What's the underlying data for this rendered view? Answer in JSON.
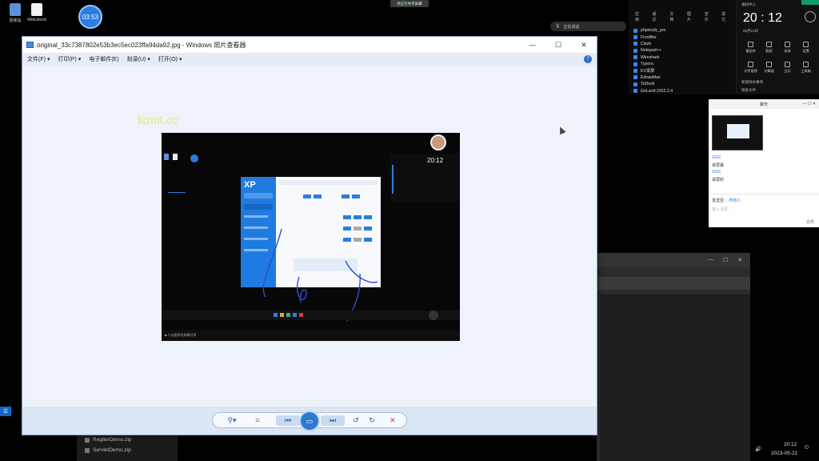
{
  "desktop": {
    "icons": [
      {
        "label": "回收站",
        "icon": "recycle-bin-icon"
      },
      {
        "label": "WebJsond",
        "icon": "document-icon"
      }
    ],
    "timer": "03:53",
    "top_banner": "你正在共享屏幕",
    "voice_chip": "正在讲话"
  },
  "launcher": {
    "tabs": [
      "应用",
      "最近",
      "文档",
      "图片",
      "音乐",
      "其它"
    ],
    "apps": [
      "phpstudy_pro",
      "FrostBer",
      "Clash",
      "Notepad++",
      "Wireshark",
      "Typora",
      "EV录屏",
      "EdrawMax",
      "ToDesk",
      "GoLand 2022.2.4"
    ]
  },
  "clock_panel": {
    "header": "通知中心",
    "time": "20 : 12",
    "date": "05月21日",
    "items": [
      "番茄钟",
      "截图",
      "录屏",
      "设置",
      "文件管理",
      "计算器",
      "日历",
      "工具箱"
    ],
    "footer1": "新建待办事项",
    "footer2": "搜索文件"
  },
  "chat": {
    "title": "聊天",
    "messages": [
      {
        "text": "GGC",
        "blue": true
      },
      {
        "text": "讲屏幕",
        "blue": false
      },
      {
        "text": "GGC",
        "blue": true
      },
      {
        "text": "讲屏的",
        "blue": false
      }
    ],
    "send_to_label": "发送至：",
    "send_to_value": "所有人",
    "input_placeholder": "输入消息...",
    "file_label": "文件"
  },
  "viewer": {
    "title": "original_33c7387802e53b3ec5ec023ffa94da92.jpg - Windows 照片查看器",
    "menu": [
      "文件(F)",
      "打印(P)",
      "电子邮件(E)",
      "刻录(U)",
      "打开(O)"
    ],
    "watermark": "fcmit.cc",
    "controls": {
      "minimize": "—",
      "maximize": "☐",
      "close": "✕",
      "help": "?"
    },
    "toolbar": {
      "zoom": "⚲▾",
      "fit": "⌗",
      "prev": "⏮",
      "slideshow": "▭",
      "next": "⏭",
      "rotate_ccw": "↺",
      "rotate_cw": "↻",
      "delete": "✕"
    }
  },
  "photo": {
    "app_brand": "XP",
    "footer_text": "小派管家的屏幕共享"
  },
  "taskbar": {
    "files": [
      "RegiterDemo.zip",
      "ServletDemo.zip"
    ],
    "tray_time": "20:12",
    "tray_date": "2023-05-21"
  },
  "colors": {
    "accent": "#1f7be0",
    "chat_blue": "#2a6fd6",
    "delete_red": "#d23a3a",
    "watermark": "#dff07a"
  }
}
